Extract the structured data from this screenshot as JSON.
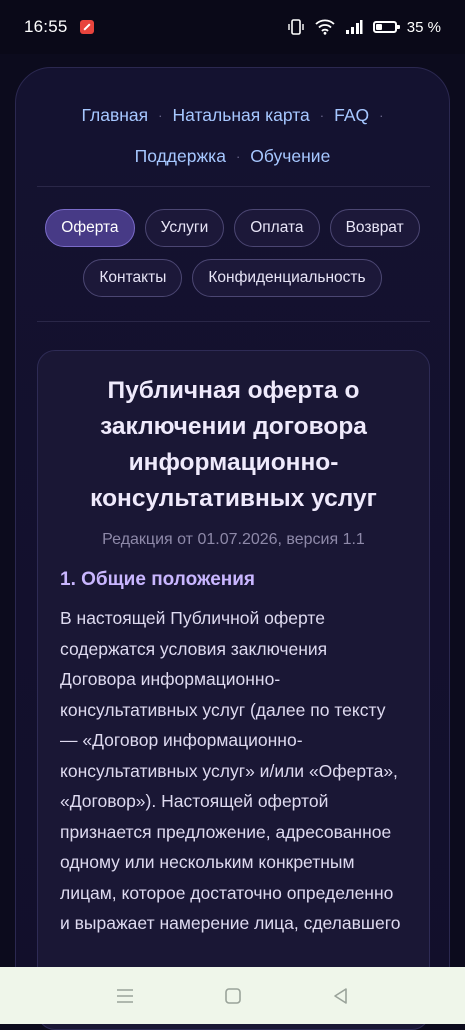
{
  "status_bar": {
    "time": "16:55",
    "battery_text": "35 %",
    "icons": [
      "notification-icon",
      "vibrate-icon",
      "wifi-icon",
      "signal-icon",
      "battery-icon"
    ]
  },
  "nav": {
    "row1": [
      "Главная",
      "Натальная карта",
      "FAQ"
    ],
    "row2": [
      "Поддержка",
      "Обучение"
    ],
    "separator": "·"
  },
  "tabs": {
    "row1": [
      "Оферта",
      "Услуги",
      "Оплата",
      "Возврат"
    ],
    "row2": [
      "Контакты",
      "Конфиденциальность"
    ],
    "active": "Оферта"
  },
  "document": {
    "title": "Публичная оферта о заключении договора информационно-консультативных услуг",
    "edition": "Редакция от 01.07.2026, версия 1.1",
    "section_title": "1. Общие положения",
    "body": "В настоящей Публичной оферте содержатся условия заключения Договора информационно-консультативных услуг (далее по тексту — «Договор информационно-консультативных услуг» и/или «Оферта», «Договор»). Настоящей офертой признается предложение, адресованное одному или нескольким конкретным лицам, которое достаточно определенно и выражает намерение лица, сделавшего"
  },
  "system_nav": {
    "icons": [
      "menu-icon",
      "home-icon",
      "back-icon"
    ]
  },
  "colors": {
    "background": "#0c0b1d",
    "nav_link": "#a6c7ff",
    "active_tab": "#473a86",
    "section_title": "#c9b6ff"
  }
}
